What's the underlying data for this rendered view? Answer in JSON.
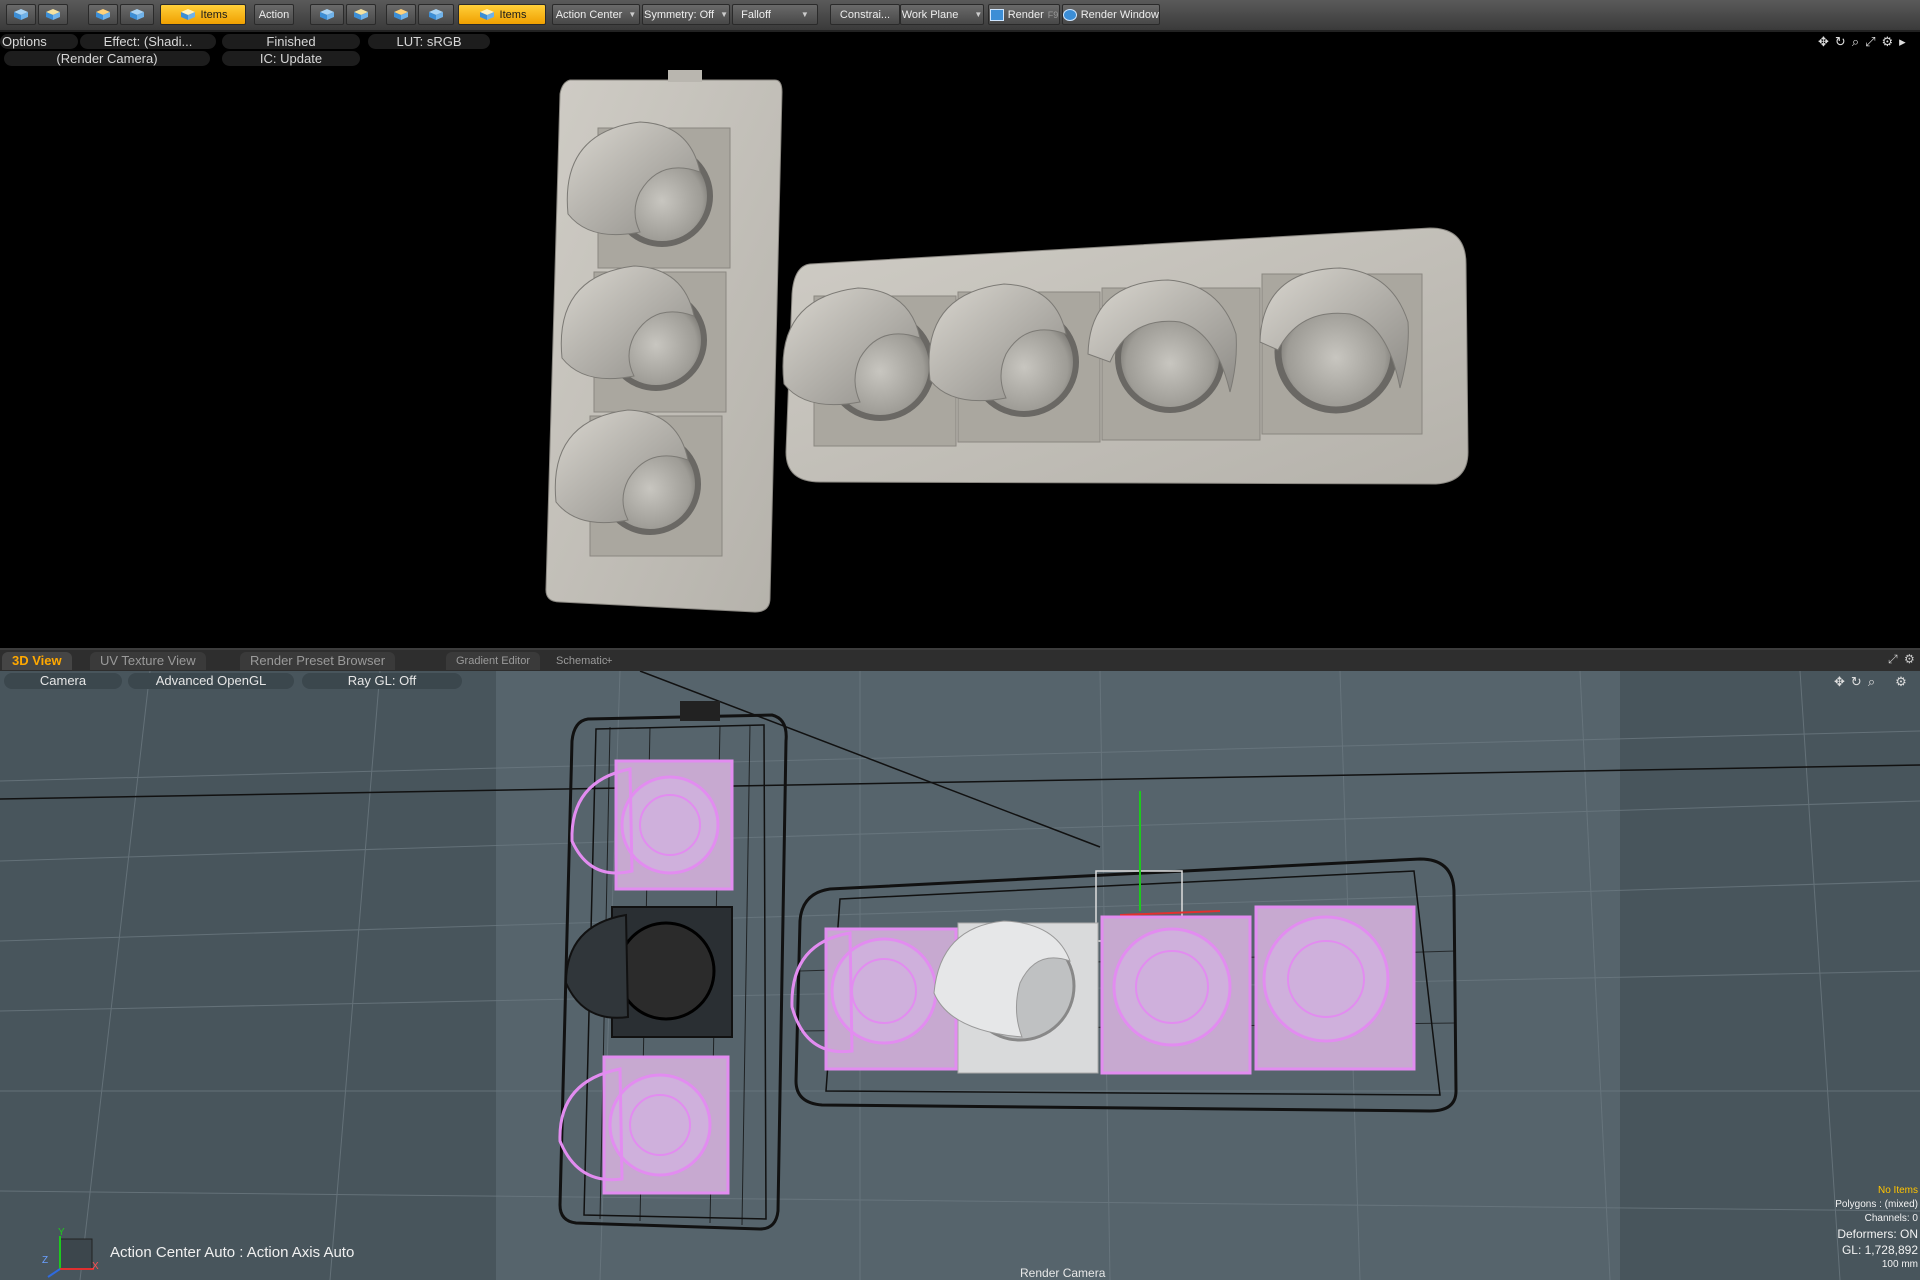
{
  "toolbar": {
    "items_label_1": "Items",
    "action_label": "Action",
    "items_label_2": "Items",
    "action_center": "Action Center",
    "symmetry": "Symmetry: Off",
    "falloff": "Falloff",
    "constraints": "Constrai...",
    "work_plane": "Work Plane",
    "render": "Render",
    "render_shortcut": "F9",
    "render_window": "Render Window"
  },
  "render_view": {
    "options": "Options",
    "effect": "Effect: (Shadi...",
    "status": "Finished",
    "lut": "LUT: sRGB",
    "camera": "(Render Camera)",
    "ic": "IC: Update"
  },
  "tabs": [
    "3D View",
    "UV Texture View",
    "Render Preset Browser",
    "Gradient Editor",
    "Schematic",
    "+"
  ],
  "gl_view": {
    "camera": "Camera",
    "shading": "Advanced OpenGL",
    "ray_gl": "Ray GL: Off",
    "action_center_status": "Action Center Auto : Action Axis Auto",
    "render_camera_label": "Render Camera",
    "axis": {
      "y": "Y",
      "z": "Z",
      "x": "X"
    }
  },
  "stats": {
    "selection": "No Items",
    "polygons": "Polygons : (mixed)",
    "channels": "Channels: 0",
    "deformers": "Deformers: ON",
    "gl": "GL: 1,728,892",
    "scale": "100 mm"
  },
  "colors": {
    "accent": "#f0a000",
    "active_tab_text": "#ffa800",
    "selection_wire": "#e28cf0",
    "viewport_bg": "#56646c",
    "warning_text": "#ffc400"
  },
  "icons": [
    "cube-icon",
    "move-icon",
    "rotate-icon",
    "zoom-icon",
    "maximize-icon",
    "gear-icon",
    "chevron-right-icon"
  ]
}
